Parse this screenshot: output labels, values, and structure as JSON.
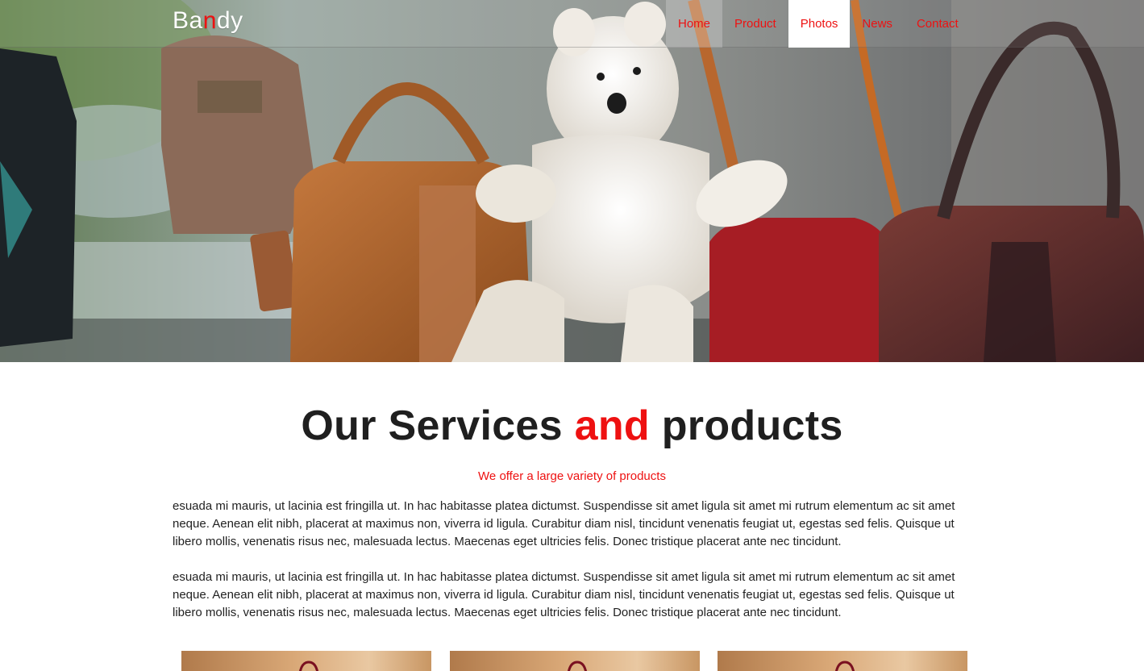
{
  "brand": {
    "part1": "Ba",
    "accent": "n",
    "part2": "dy"
  },
  "nav": {
    "items": [
      {
        "label": "Home"
      },
      {
        "label": "Product"
      },
      {
        "label": "Photos"
      },
      {
        "label": "News"
      },
      {
        "label": "Contact"
      }
    ],
    "active": "Photos"
  },
  "services": {
    "title_part1": "Our Services ",
    "title_accent": "and",
    "title_part2": " products",
    "subtitle": "We offer a large variety of products",
    "paragraphs": [
      "esuada mi mauris, ut lacinia est fringilla ut. In hac habitasse platea dictumst. Suspendisse sit amet ligula sit amet mi rutrum elementum ac sit amet neque. Aenean elit nibh, placerat at maximus non, viverra id ligula. Curabitur diam nisl, tincidunt venenatis feugiat ut, egestas sed felis. Quisque ut libero mollis, venenatis risus nec, malesuada lectus. Maecenas eget ultricies felis. Donec tristique placerat ante nec tincidunt.",
      "esuada mi mauris, ut lacinia est fringilla ut. In hac habitasse platea dictumst. Suspendisse sit amet ligula sit amet mi rutrum elementum ac sit amet neque. Aenean elit nibh, placerat at maximus non, viverra id ligula. Curabitur diam nisl, tincidunt venenatis feugiat ut, egestas sed felis. Quisque ut libero mollis, venenatis risus nec, malesuada lectus. Maecenas eget ultricies felis. Donec tristique placerat ante nec tincidunt."
    ]
  },
  "colors": {
    "accent": "#ee1111",
    "text": "#222222"
  }
}
